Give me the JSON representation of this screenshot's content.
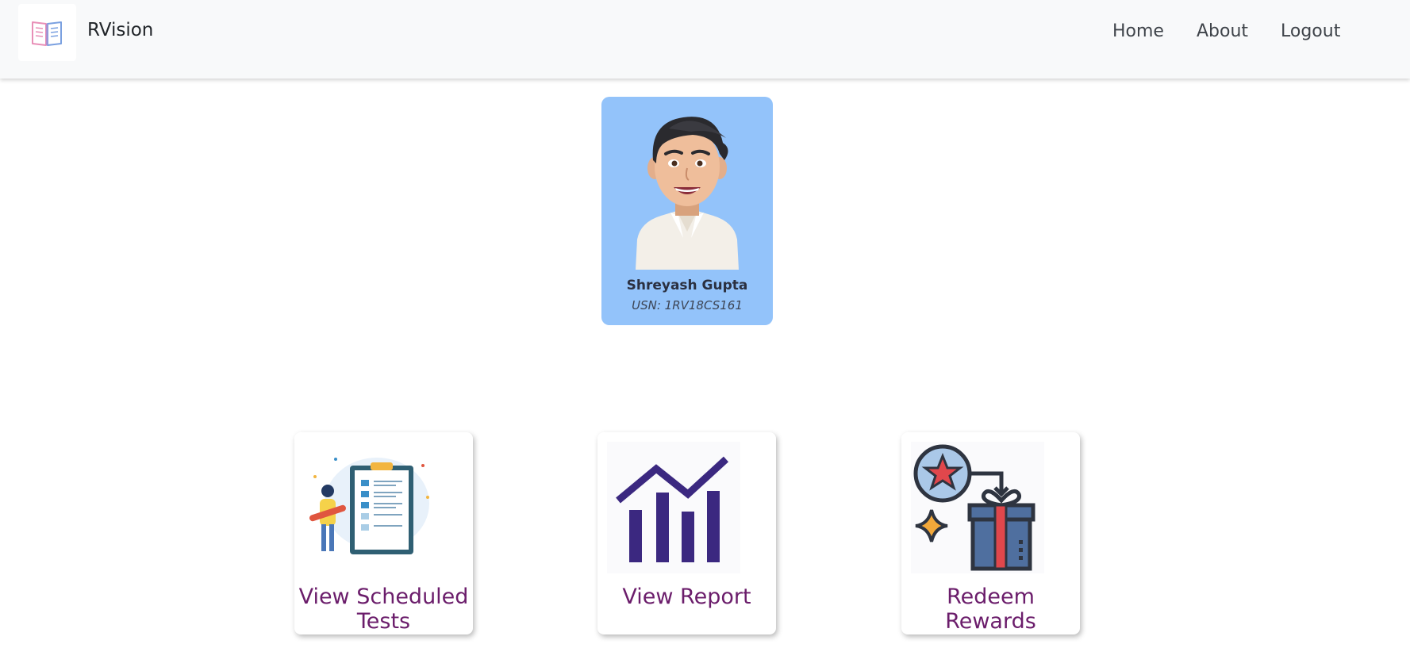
{
  "navbar": {
    "brand": "RVision",
    "links": [
      "Home",
      "About",
      "Logout"
    ]
  },
  "profile": {
    "name": "Shreyash Gupta",
    "usn": "USN: 1RV18CS161"
  },
  "actions": [
    {
      "title": "View Scheduled Tests",
      "icon": "clipboard-checklist-icon"
    },
    {
      "title": "View Report",
      "icon": "chart-growth-icon"
    },
    {
      "title": "Redeem Rewards",
      "icon": "gift-reward-icon"
    }
  ],
  "colors": {
    "navbar_bg": "#f8f9fa",
    "profile_card_bg": "#93c3fa",
    "action_title": "#6b1d6b",
    "report_icon": "#3b2880"
  }
}
